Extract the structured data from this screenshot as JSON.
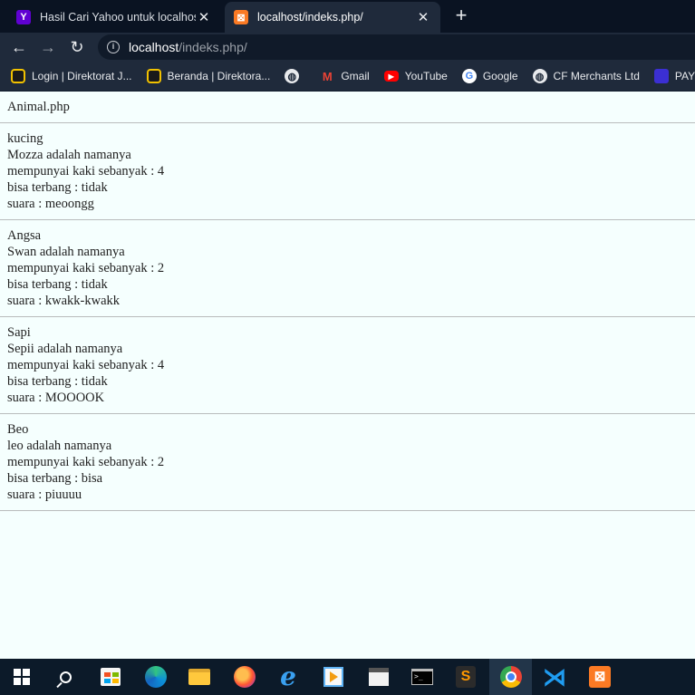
{
  "browser": {
    "tabs": [
      {
        "title": "Hasil Cari Yahoo untuk localhost/",
        "favicon": "yahoo-icon",
        "active": false
      },
      {
        "title": "localhost/indeks.php/",
        "favicon": "xampp-icon",
        "active": true
      }
    ],
    "address": {
      "host": "localhost",
      "path": "/indeks.php/"
    },
    "bookmarks": [
      {
        "label": "Login | Direktorat J...",
        "icon": "direktorat-icon"
      },
      {
        "label": "Beranda | Direktora...",
        "icon": "direktorat-icon"
      },
      {
        "label": "",
        "icon": "globe-icon"
      },
      {
        "label": "Gmail",
        "icon": "gmail-icon"
      },
      {
        "label": "YouTube",
        "icon": "youtube-icon"
      },
      {
        "label": "Google",
        "icon": "google-icon"
      },
      {
        "label": "CF Merchants Ltd",
        "icon": "globe-icon"
      },
      {
        "label": "PAYCA",
        "icon": "payca-icon"
      }
    ]
  },
  "page": {
    "heading": "Animal.php",
    "animals": [
      {
        "species": "kucing",
        "name_line": "Mozza adalah namanya",
        "legs_line": "mempunyai kaki sebanyak : 4",
        "fly_line": "bisa terbang : tidak",
        "sound_line": "suara : meoongg"
      },
      {
        "species": "Angsa",
        "name_line": "Swan adalah namanya",
        "legs_line": "mempunyai kaki sebanyak : 2",
        "fly_line": "bisa terbang : tidak",
        "sound_line": "suara : kwakk-kwakk"
      },
      {
        "species": "Sapi",
        "name_line": "Sepii adalah namanya",
        "legs_line": "mempunyai kaki sebanyak : 4",
        "fly_line": "bisa terbang : tidak",
        "sound_line": "suara : MOOOOK"
      },
      {
        "species": "Beo",
        "name_line": "leo adalah namanya",
        "legs_line": "mempunyai kaki sebanyak : 2",
        "fly_line": "bisa terbang : bisa",
        "sound_line": "suara : piuuuu"
      }
    ]
  },
  "taskbar": {
    "apps": [
      "start-icon",
      "search-icon",
      "store-icon",
      "edge-icon",
      "file-explorer-icon",
      "firefox-icon",
      "internet-explorer-icon",
      "media-player-icon",
      "video-editor-icon",
      "terminal-icon",
      "sublime-text-icon",
      "chrome-icon",
      "vscode-icon",
      "xampp-icon"
    ],
    "active_app": "chrome-icon"
  },
  "colors": {
    "page_bg": "#f5fffe",
    "chrome_bg": "#1f2a3b",
    "tabstrip_bg": "#0a1322",
    "taskbar_bg": "#0c1a29"
  }
}
